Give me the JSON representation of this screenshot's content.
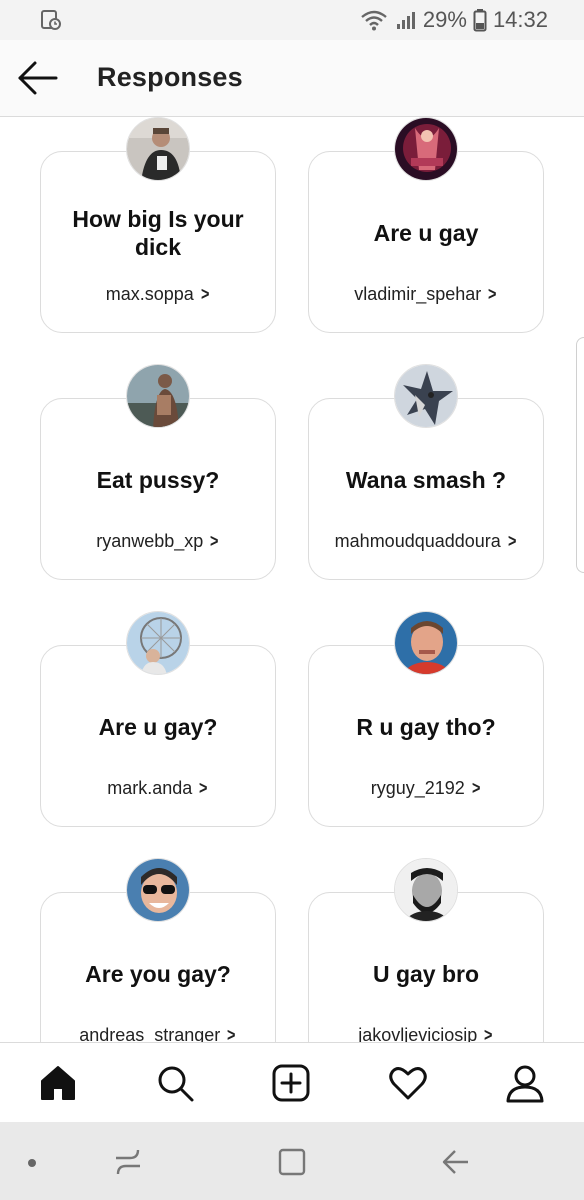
{
  "status_bar": {
    "battery": "29%",
    "time": "14:32"
  },
  "header": {
    "title": "Responses"
  },
  "responses": [
    {
      "question": "How big Is your dick",
      "username": "max.soppa",
      "chevron": ">"
    },
    {
      "question": "Are u gay",
      "username": "vladimir_spehar",
      "chevron": ">"
    },
    {
      "question": "Eat pussy?",
      "username": "ryanwebb_xp",
      "chevron": ">"
    },
    {
      "question": "Wana smash ?",
      "username": "mahmoudquaddoura",
      "chevron": ">"
    },
    {
      "question": "Are u gay?",
      "username": "mark.anda",
      "chevron": ">"
    },
    {
      "question": "R u gay tho?",
      "username": "ryguy_2192",
      "chevron": ">"
    },
    {
      "question": "Are you gay?",
      "username": "andreas_stranger",
      "chevron": ">"
    },
    {
      "question": "U gay bro",
      "username": "jakovljeviciosip",
      "chevron": ">"
    }
  ],
  "bottom_nav": [
    "home-icon",
    "search-icon",
    "add-post-icon",
    "activity-heart-icon",
    "profile-icon"
  ],
  "system_nav": [
    "dot-icon",
    "recent-apps-icon",
    "home-square-icon",
    "system-back-icon"
  ]
}
